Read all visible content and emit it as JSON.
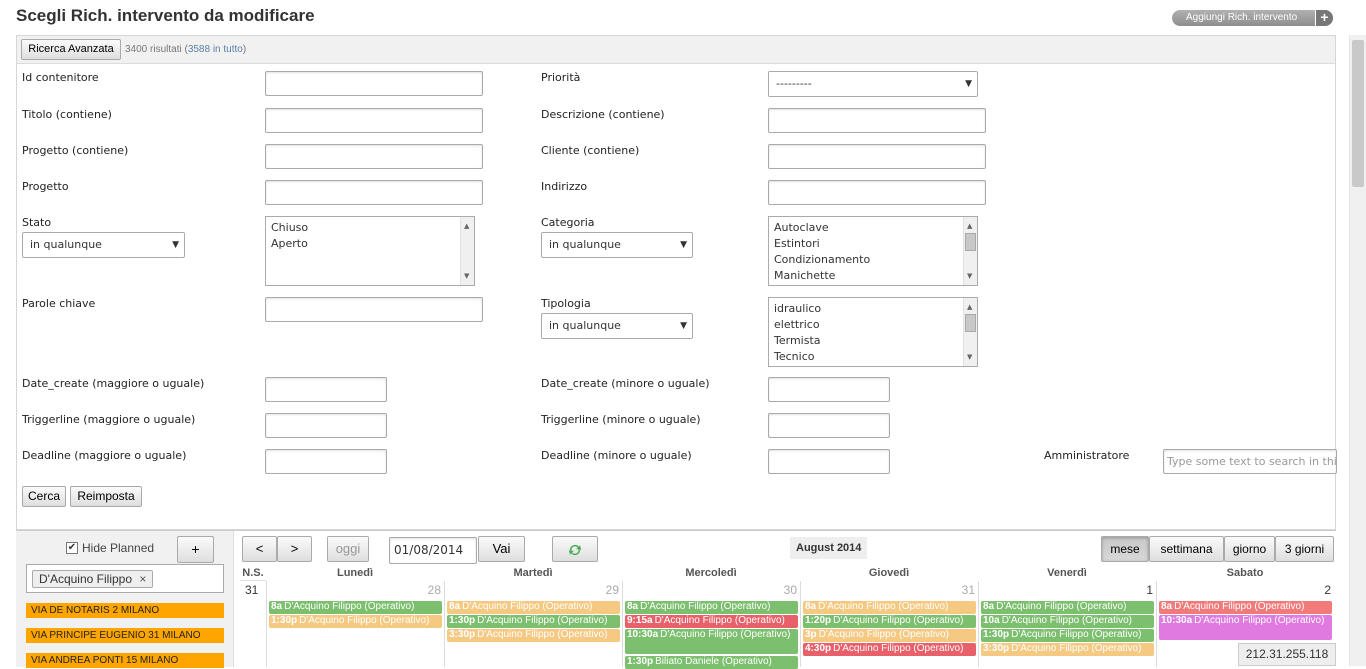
{
  "header": {
    "title": "Scegli Rich. intervento da modificare",
    "add_label": "Aggiungi Rich. intervento",
    "add_icon": "plus-icon"
  },
  "toolbar": {
    "advanced_search": "Ricerca Avanzata",
    "results_text": "3400 risultati (",
    "results_link": "3588 in tutto",
    "results_close": ")"
  },
  "filters": {
    "id_contenitore": "Id contenitore",
    "priorita": "Priorità",
    "priorita_value": "---------",
    "titolo": "Titolo (contiene)",
    "descrizione": "Descrizione (contiene)",
    "progetto_contiene": "Progetto (contiene)",
    "cliente": "Cliente (contiene)",
    "progetto": "Progetto",
    "indirizzo": "Indirizzo",
    "stato": "Stato",
    "stato_select": "in qualunque",
    "stato_options": [
      "Chiuso",
      "Aperto"
    ],
    "categoria": "Categoria",
    "categoria_select": "in qualunque",
    "categoria_options": [
      "Autoclave",
      "Estintori",
      "Condizionamento",
      "Manichette"
    ],
    "parole_chiave": "Parole chiave",
    "tipologia": "Tipologia",
    "tipologia_select": "in qualunque",
    "tipologia_options": [
      "idraulico",
      "elettrico",
      "Termista",
      "Tecnico"
    ],
    "date_create_gte": "Date_create (maggiore o uguale)",
    "date_create_lte": "Date_create (minore o uguale)",
    "triggerline_gte": "Triggerline (maggiore o uguale)",
    "triggerline_lte": "Triggerline (minore o uguale)",
    "deadline_gte": "Deadline (maggiore o uguale)",
    "deadline_lte": "Deadline (minore o uguale)",
    "amministratore": "Amministratore",
    "amministratore_placeholder": "Type some text to search in this",
    "cerca": "Cerca",
    "reimposta": "Reimposta"
  },
  "sidebar": {
    "hide_planned": "Hide Planned",
    "hide_planned_checked": true,
    "add": "+",
    "tag": "D'Acquino Filippo",
    "tag_remove": "×",
    "addresses": [
      "VIA DE NOTARIS 2 MILANO",
      "VIA PRINCIPE EUGENIO 31 MILANO",
      "VIA ANDREA PONTI 15 MILANO"
    ]
  },
  "calendar": {
    "prev": "<",
    "next": ">",
    "today": "oggi",
    "date_value": "01/08/2014",
    "go": "Vai",
    "refresh_icon": "refresh-icon",
    "month_title": "August 2014",
    "views": [
      "mese",
      "settimana",
      "giorno",
      "3 giorni"
    ],
    "active_view": "mese",
    "week_col": "N.S.",
    "week_num": "31",
    "days": [
      {
        "name": "Lunedì",
        "num": "28",
        "current": false,
        "events": [
          {
            "time": "8a",
            "text": "D'Acquino Filippo (Operativo)",
            "color": "#7cbf6e"
          },
          {
            "time": "1:30p",
            "text": "D'Acquino Filippo (Operativo)",
            "color": "#f5c982"
          }
        ]
      },
      {
        "name": "Martedì",
        "num": "29",
        "current": false,
        "events": [
          {
            "time": "8a",
            "text": "D'Acquino Filippo (Operativo)",
            "color": "#f5c982"
          },
          {
            "time": "1:30p",
            "text": "D'Acquino Filippo (Operativo)",
            "color": "#7cbf6e"
          },
          {
            "time": "3:30p",
            "text": "D'Acquino Filippo (Operativo)",
            "color": "#f5c982"
          }
        ]
      },
      {
        "name": "Mercoledì",
        "num": "30",
        "current": false,
        "events": [
          {
            "time": "8a",
            "text": "D'Acquino Filippo (Operativo)",
            "color": "#7cbf6e"
          },
          {
            "time": "9:15a",
            "text": "D'Acquino Filippo (Operativo)",
            "color": "#e8606a"
          },
          {
            "time": "10:30a",
            "text": "D'Acquino Filippo (Operativo)",
            "color": "#7cbf6e",
            "wrap": true
          },
          {
            "time": "1:30p",
            "text": "Biliato Daniele (Operativo)",
            "color": "#7cbf6e"
          }
        ]
      },
      {
        "name": "Giovedì",
        "num": "31",
        "current": false,
        "events": [
          {
            "time": "8a",
            "text": "D'Acquino Filippo (Operativo)",
            "color": "#f5c982"
          },
          {
            "time": "1:20p",
            "text": "D'Acquino Filippo (Operativo)",
            "color": "#7cbf6e"
          },
          {
            "time": "3p",
            "text": "D'Acquino Filippo (Operativo)",
            "color": "#f5c982"
          },
          {
            "time": "4:30p",
            "text": "D'Acquino Filippo (Operativo)",
            "color": "#e8606a"
          }
        ]
      },
      {
        "name": "Venerdì",
        "num": "1",
        "current": true,
        "events": [
          {
            "time": "8a",
            "text": "D'Acquino Filippo (Operativo)",
            "color": "#7cbf6e"
          },
          {
            "time": "10a",
            "text": "D'Acquino Filippo (Operativo)",
            "color": "#7cbf6e"
          },
          {
            "time": "1:30p",
            "text": "D'Acquino Filippo (Operativo)",
            "color": "#7cbf6e"
          },
          {
            "time": "3:30p",
            "text": "D'Acquino Filippo (Operativo)",
            "color": "#f5c982"
          }
        ]
      },
      {
        "name": "Sabato",
        "num": "2",
        "current": true,
        "events": [
          {
            "time": "8a",
            "text": "D'Acquino Filippo (Operativo)",
            "color": "#f17b7b"
          },
          {
            "time": "10:30a",
            "text": "D'Acquino Filippo (Operativo)",
            "color": "#e07ae0",
            "wrap": true
          }
        ]
      }
    ]
  },
  "status": {
    "ip": "212.31.255.118"
  }
}
